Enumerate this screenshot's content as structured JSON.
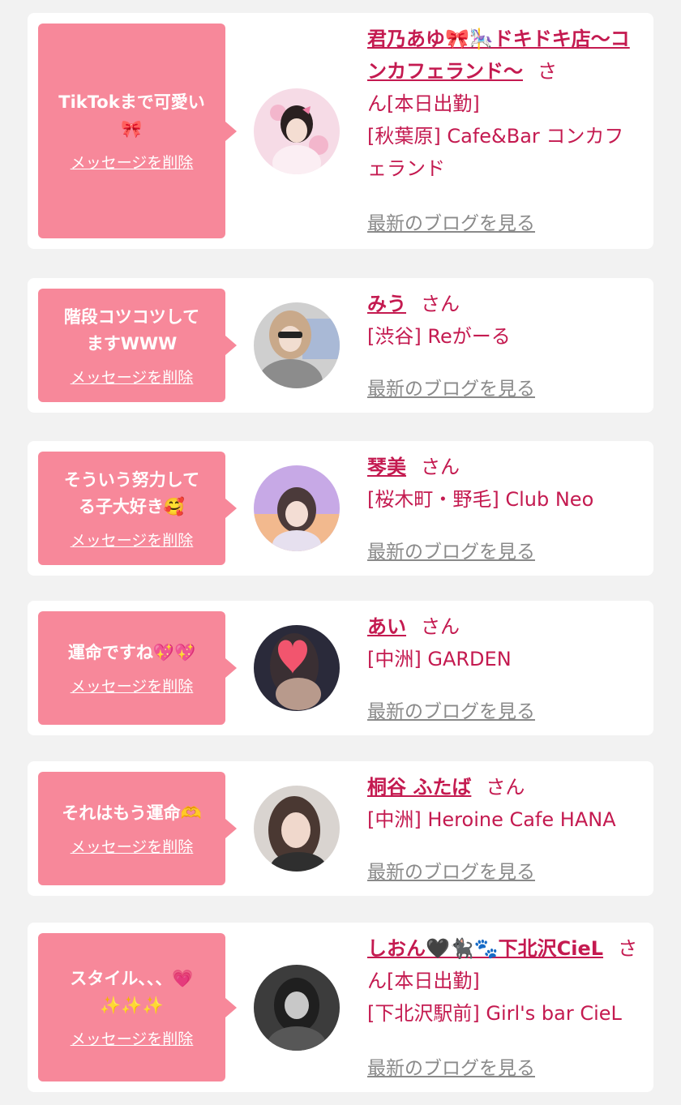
{
  "items": [
    {
      "message": "TikTokまで可愛い\n🎀",
      "delete_label": "メッセージを削除",
      "name": "君乃あゆ🎀🎠ドキドキ店〜コンカフェランド〜",
      "honorific": "さ\nん",
      "status": "[本日出勤]",
      "shop": "[秋葉原] Cafe&Bar コンカフェランド",
      "blog_label": "最新のブログを見る"
    },
    {
      "message": "階段コツコツして\nますWWW",
      "delete_label": "メッセージを削除",
      "name": "みう",
      "honorific": "さん",
      "status": "",
      "shop": "[渋谷] Reがーる",
      "blog_label": "最新のブログを見る"
    },
    {
      "message": "そういう努力して\nる子大好き🥰",
      "delete_label": "メッセージを削除",
      "name": "琴美",
      "honorific": "さん",
      "status": "",
      "shop": "[桜木町・野毛] Club Neo",
      "blog_label": "最新のブログを見る"
    },
    {
      "message": "運命ですね💖💖",
      "delete_label": "メッセージを削除",
      "name": "あい",
      "honorific": "さん",
      "status": "",
      "shop": "[中洲] GARDEN",
      "blog_label": "最新のブログを見る"
    },
    {
      "message": "それはもう運命🫶",
      "delete_label": "メッセージを削除",
      "name": "桐谷 ふたば",
      "honorific": "さん",
      "status": "",
      "shop": "[中洲] Heroine Cafe HANA",
      "blog_label": "最新のブログを見る"
    },
    {
      "message": "スタイル、、、💗\n✨✨✨",
      "delete_label": "メッセージを削除",
      "name": "しおん🖤🐈‍⬛🐾下北沢CieL",
      "honorific": "さん",
      "status": "[本日出勤]",
      "shop": "[下北沢駅前] Girl's bar CieL",
      "blog_label": "最新のブログを見る"
    }
  ]
}
